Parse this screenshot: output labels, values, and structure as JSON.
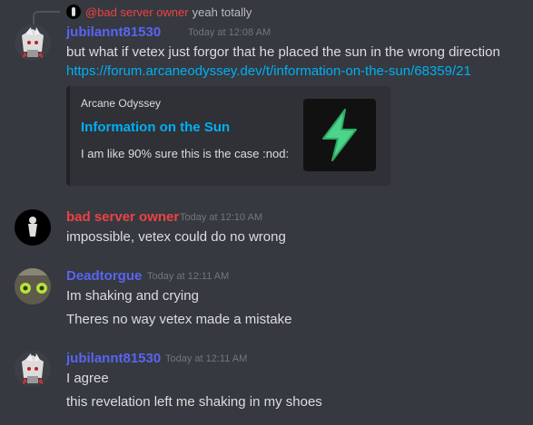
{
  "reply": {
    "mention": "@bad server owner",
    "text": "yeah totally",
    "mention_color": "#ed4245"
  },
  "messages": [
    {
      "author": "jubilannt81530",
      "author_color": "#5865f2",
      "timestamp": "Today at 12:08 AM",
      "lines": [
        "but what if vetex just forgor that he placed the sun in the wrong direction"
      ],
      "link": "https://forum.arcaneodyssey.dev/t/information-on-the-sun/68359/21",
      "embed": {
        "site": "Arcane Odyssey",
        "title": "Information on the Sun",
        "description": "I am like 90% sure this is the case :nod:",
        "thumbnail_icon": "lightning-bolt-icon"
      }
    },
    {
      "author": "bad server owner",
      "author_color": "#ed4245",
      "timestamp": "Today at 12:10 AM",
      "lines": [
        "impossible, vetex could do no wrong"
      ]
    },
    {
      "author": "Deadtorgue",
      "author_color": "#5865f2",
      "timestamp": "Today at 12:11 AM",
      "lines": [
        "Im shaking and crying",
        "Theres no way vetex made a mistake"
      ]
    },
    {
      "author": "jubilannt81530",
      "author_color": "#5865f2",
      "timestamp": "Today at 12:11 AM",
      "lines": [
        "I agree",
        "this revelation left me shaking in my shoes"
      ]
    }
  ]
}
